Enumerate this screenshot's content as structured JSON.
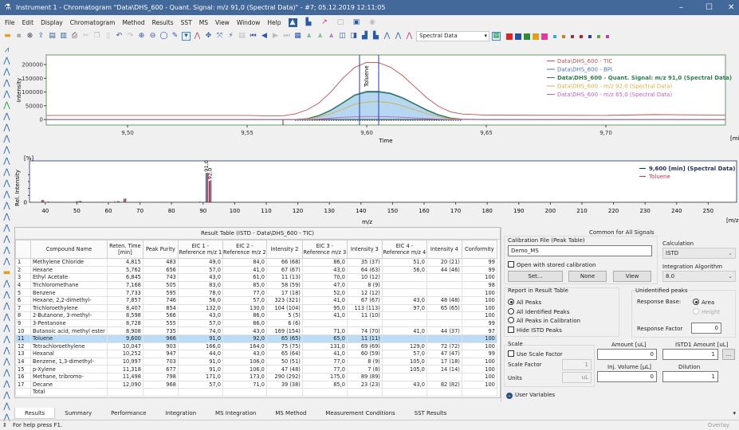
{
  "window": {
    "title": "Instrument 1 - Chromatogram \"Data\\DHS_600 - Quant. Signal: m/z 91,0 (Spectral Data)\" - #7;   05.12.2019   12:11:05",
    "minimize": "–",
    "maximize": "☐",
    "close": "✕"
  },
  "menu": [
    "File",
    "Edit",
    "Display",
    "Chromatogram",
    "Method",
    "Results",
    "SST",
    "MS",
    "View",
    "Window",
    "Help"
  ],
  "toolbar": {
    "signal_select": "Spectral Data",
    "trace_colors": [
      "#d9262b",
      "#2a4fa8",
      "#2e8b3a",
      "#e0a020",
      "#e03aa0"
    ],
    "small_colors": [
      "#3bb0c8",
      "#c87c28",
      "#a03040",
      "#b02030",
      "#304090",
      "#70a040",
      "#c040a0"
    ]
  },
  "chromatogram": {
    "chart_data": {
      "type": "line",
      "xlabel": "Time",
      "ylabel": "Intensity",
      "xunit": "[min]",
      "xlim": [
        9.466,
        9.75
      ],
      "ylim": [
        -20000,
        235000
      ],
      "xticks": [
        "9,50",
        "9,55",
        "9,60",
        "9,65",
        "9,70"
      ],
      "xtick_values": [
        9.5,
        9.55,
        9.6,
        9.65,
        9.7
      ],
      "yticks": [
        "0",
        "50000",
        "100000",
        "150000",
        "200000"
      ],
      "ytick_values": [
        0,
        50000,
        100000,
        150000,
        200000
      ],
      "peak_label": "Toluene",
      "peak_marker_times": [
        9.597,
        9.605
      ],
      "x": [
        9.466,
        9.55,
        9.56,
        9.565,
        9.57,
        9.575,
        9.58,
        9.585,
        9.59,
        9.595,
        9.6,
        9.605,
        9.61,
        9.615,
        9.62,
        9.625,
        9.63,
        9.635,
        9.64,
        9.65,
        9.7,
        9.72,
        9.75
      ],
      "series": [
        {
          "name": "Data\\DHS_600 - TIC",
          "color": "#c0504d",
          "values": [
            15000,
            15000,
            13000,
            14000,
            20000,
            35000,
            60000,
            100000,
            150000,
            190000,
            208000,
            207000,
            190000,
            160000,
            120000,
            80000,
            48000,
            28000,
            20000,
            16000,
            15000,
            18000,
            16000
          ]
        },
        {
          "name": "Data\\DHS_600 - BPI",
          "color": "#4f6fb0",
          "values": [
            0,
            0,
            0,
            0,
            0,
            3000,
            15000,
            35000,
            62000,
            90000,
            103000,
            103000,
            96000,
            80000,
            58000,
            36000,
            18000,
            6000,
            1000,
            0,
            0,
            0,
            0
          ]
        },
        {
          "name": "Data\\DHS_600 - Quant. Signal: m/z 91,0 (Spectral Data)",
          "color": "#2e7d4f",
          "bold": true,
          "values": [
            0,
            0,
            0,
            0,
            0,
            2500,
            14000,
            33000,
            60000,
            88000,
            100000,
            100000,
            94000,
            78000,
            56000,
            34000,
            16000,
            5000,
            800,
            0,
            0,
            0,
            0
          ]
        },
        {
          "name": "Data\\DHS_600 - m/z 92,0 (Spectral Data)",
          "color": "#d4b040",
          "values": [
            0,
            0,
            0,
            0,
            0,
            1500,
            9000,
            21000,
            38000,
            56000,
            64000,
            65000,
            61000,
            50000,
            36000,
            22000,
            10000,
            3000,
            500,
            0,
            0,
            0,
            0
          ]
        },
        {
          "name": "Data\\DHS_600 - m/z 65,0 (Spectral Data)",
          "color": "#c060c0",
          "values": [
            0,
            0,
            0,
            0,
            0,
            500,
            2000,
            5000,
            8000,
            10000,
            11000,
            11000,
            10000,
            8000,
            6000,
            3500,
            1500,
            500,
            0,
            0,
            0,
            0,
            0
          ]
        }
      ],
      "legend": "top-right",
      "fill_series": "Data\\DHS_600 - Quant. Signal: m/z 91,0 (Spectral Data)",
      "fill_color": "#a8d0ef"
    }
  },
  "spectrum": {
    "chart_data": {
      "type": "bar",
      "xlabel": "m/z",
      "ylabel": "Rel. Intensity",
      "yunit": "[%]",
      "xunit": "[m/z]",
      "xlim": [
        35,
        259
      ],
      "ylim": [
        0,
        120
      ],
      "xticks": [
        "40",
        "50",
        "60",
        "70",
        "80",
        "90",
        "100",
        "110",
        "120",
        "130",
        "140",
        "150",
        "160",
        "170",
        "180",
        "190",
        "200",
        "210",
        "220",
        "230",
        "240",
        "250"
      ],
      "ytick": "0",
      "peak_labels": [
        "91,0",
        "92,0"
      ],
      "series": [
        {
          "name": "9,600 [min] (Spectral Data)",
          "color": "#1f2d5a",
          "mz": [
            39,
            41,
            43,
            45,
            50,
            51,
            62,
            63,
            65,
            77,
            89,
            91,
            92
          ],
          "values": [
            7,
            2,
            1,
            1,
            3,
            4,
            2,
            3,
            10,
            1,
            2,
            85,
            62
          ]
        },
        {
          "name": "Toluene",
          "color": "#c0304d",
          "mz": [
            39,
            50,
            51,
            63,
            65,
            91,
            92
          ],
          "values": [
            6,
            3,
            3,
            3,
            11,
            86,
            64
          ]
        }
      ],
      "legend": "top-right"
    }
  },
  "result_table": {
    "title": "Result Table (ISTD - Data\\DHS_600 - TIC)",
    "columns": [
      "",
      "Compound Name",
      "Reten. Time [min]",
      "Peak Purity",
      "EIC 1 - Reference m/z 1",
      "EIC 2 - Reference m/z 2",
      "Intensity 2",
      "EIC 3 - Reference m/z 3",
      "Intensity 3",
      "EIC 4 - Reference m/z 4",
      "Intensity 4",
      "Conformity"
    ],
    "rows": [
      [
        "1",
        "Methylene Chloride",
        "4,815",
        "483",
        "49,0",
        "84,0",
        "66 (68)",
        "86,0",
        "35 (37)",
        "51,0",
        "20 (21)",
        "99"
      ],
      [
        "2",
        "Hexane",
        "5,762",
        "656",
        "57,0",
        "41,0",
        "67 (67)",
        "43,0",
        "64 (63)",
        "56,0",
        "44 (46)",
        "99"
      ],
      [
        "3",
        "Ethyl Acetate",
        "6,845",
        "743",
        "43,0",
        "61,0",
        "11 (13)",
        "70,0",
        "10 (12)",
        "",
        "",
        "100"
      ],
      [
        "4",
        "Trichloromethane",
        "7,168",
        "505",
        "83,0",
        "85,0",
        "58 (59)",
        "47,0",
        "8 (9)",
        "",
        "",
        "98"
      ],
      [
        "5",
        "Benzene",
        "7,733",
        "595",
        "78,0",
        "77,0",
        "17 (18)",
        "52,0",
        "12 (12)",
        "",
        "",
        "100"
      ],
      [
        "6",
        "Hexane, 2,2-dimethyl-",
        "7,857",
        "746",
        "56,0",
        "57,0",
        "323 (321)",
        "41,0",
        "67 (67)",
        "43,0",
        "48 (48)",
        "100"
      ],
      [
        "7",
        "Trichloroethylene",
        "8,407",
        "854",
        "132,0",
        "130,0",
        "104 (104)",
        "95,0",
        "113 (113)",
        "97,0",
        "65 (65)",
        "100"
      ],
      [
        "8",
        "2-Butanone, 3-methyl-",
        "8,598",
        "566",
        "43,0",
        "86,0",
        "5 (5)",
        "41,0",
        "11 (10)",
        "",
        "",
        "100"
      ],
      [
        "9",
        "3-Pentanone",
        "8,728",
        "555",
        "57,0",
        "86,0",
        "6 (6)",
        "",
        "",
        "",
        "",
        "99"
      ],
      [
        "10",
        "Butanoic acid, methyl ester",
        "8,908",
        "735",
        "74,0",
        "43,0",
        "169 (154)",
        "71,0",
        "74 (70)",
        "41,0",
        "44 (37)",
        "97"
      ],
      [
        "11",
        "Toluene",
        "9,600",
        "966",
        "91,0",
        "92,0",
        "65 (65)",
        "65,0",
        "11 (11)",
        "",
        "",
        "100"
      ],
      [
        "12",
        "Tetrachloroethylene",
        "10,047",
        "903",
        "166,0",
        "164,0",
        "75 (75)",
        "131,0",
        "69 (69)",
        "129,0",
        "72 (72)",
        "100"
      ],
      [
        "13",
        "Hexanal",
        "10,252",
        "947",
        "44,0",
        "43,0",
        "65 (64)",
        "41,0",
        "60 (59)",
        "57,0",
        "47 (47)",
        "99"
      ],
      [
        "14",
        "Benzene, 1,3-dimethyl-",
        "10,997",
        "703",
        "91,0",
        "106,0",
        "50 (51)",
        "77,0",
        "8 (9)",
        "105,0",
        "17 (18)",
        "100"
      ],
      [
        "15",
        "p-Xylene",
        "11,318",
        "677",
        "91,0",
        "106,0",
        "47 (48)",
        "77,0",
        "7 (8)",
        "105,0",
        "14 (14)",
        "100"
      ],
      [
        "16",
        "Methane, tribromo-",
        "11,498",
        "798",
        "171,0",
        "173,0",
        "290 (292)",
        "175,0",
        "89 (89)",
        "",
        "",
        "100"
      ],
      [
        "17",
        "Decane",
        "12,090",
        "968",
        "57,0",
        "71,0",
        "39 (38)",
        "85,0",
        "23 (23)",
        "43,0",
        "82 (82)",
        "100"
      ],
      [
        "",
        "Total",
        "",
        "",
        "",
        "",
        "",
        "",
        "",
        "",
        "",
        ""
      ]
    ],
    "selected_row": 10
  },
  "right_panel": {
    "title": "Common for All Signals",
    "calibration_label": "Calibration File (Peak Table)",
    "calibration_value": "Demo_MS",
    "open_stored": "Open with stored calibration",
    "set": "Set...",
    "none": "None",
    "view": "View",
    "calculation_label": "Calculation",
    "calculation_value": "ISTD",
    "algorithm_label": "Integration Algorithm",
    "algorithm_value": "8.0",
    "report_label": "Report in Result Table",
    "report_options": [
      "All Peaks",
      "All Identified Peaks",
      "All Peaks in Calibration"
    ],
    "report_selected": 0,
    "hide_istd": "Hide ISTD Peaks",
    "unidentified_label": "Unidentified peaks",
    "response_base": "Response Base:",
    "area": "Area",
    "height": "Height",
    "response_factor": "Response Factor",
    "response_factor_value": "0",
    "scale_label": "Scale",
    "use_scale": "Use Scale Factor",
    "scale_factor": "Scale Factor",
    "scale_factor_value": "1",
    "units": "Units",
    "units_value": "uL",
    "amount_label": "Amount [uL]",
    "amount_value": "0",
    "istd_label": "ISTD1 Amount [uL]",
    "istd_value": "1",
    "more": "...",
    "inj_label": "Inj. Volume [µL]",
    "inj_value": "0",
    "dilution_label": "Dilution",
    "dilution_value": "1",
    "user_variables": "User Variables"
  },
  "tabs": [
    "Results",
    "Summary",
    "Performance",
    "Integration",
    "MS Integration",
    "MS Method",
    "Measurement Conditions",
    "SST Results"
  ],
  "active_tab": 0,
  "status": {
    "text": "For help press F1.",
    "mode": "Overlay"
  }
}
